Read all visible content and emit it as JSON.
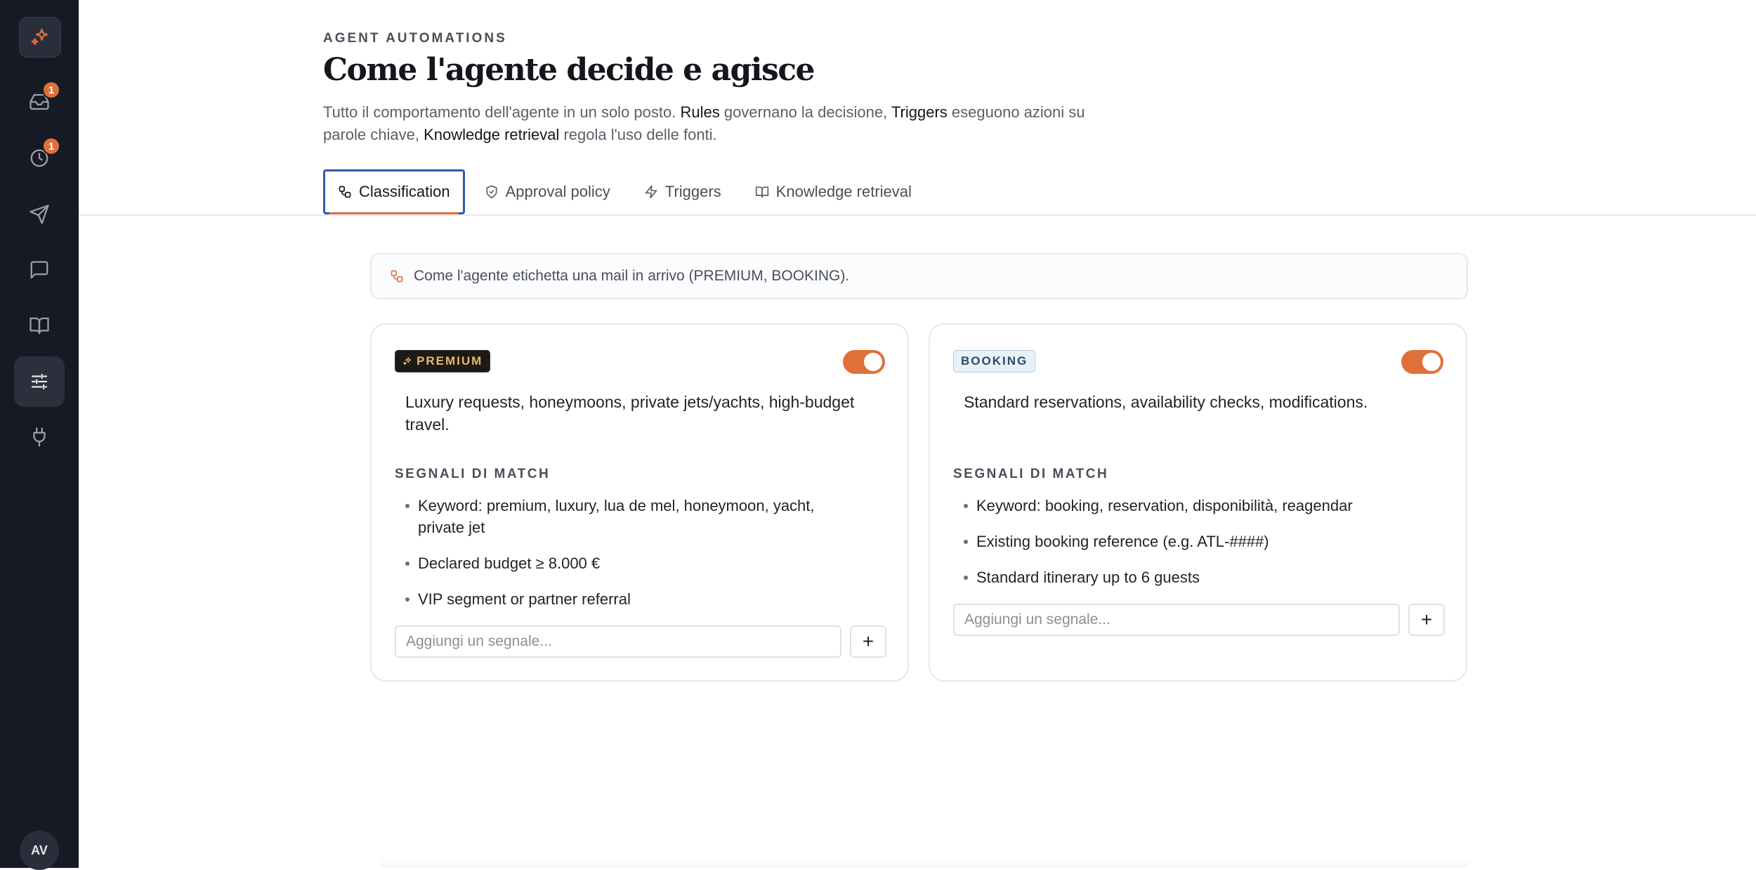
{
  "sidebar": {
    "logo_icon": "sparkle-icon",
    "items": [
      {
        "icon": "inbox-icon",
        "badge": "1"
      },
      {
        "icon": "clock-icon",
        "badge": "1"
      },
      {
        "icon": "send-icon",
        "badge": ""
      },
      {
        "icon": "chat-icon",
        "badge": ""
      },
      {
        "icon": "book-icon",
        "badge": ""
      },
      {
        "icon": "sliders-icon",
        "badge": "",
        "active": true
      },
      {
        "icon": "plug-icon",
        "badge": ""
      }
    ],
    "avatar": "AV"
  },
  "header": {
    "eyebrow": "AGENT AUTOMATIONS",
    "title": "Come l'agente decide e agisce",
    "desc_1": "Tutto il comportamento dell'agente in un solo posto. ",
    "desc_rules": "Rules",
    "desc_2": " governano la decisione, ",
    "desc_triggers": "Triggers",
    "desc_3": " eseguono azioni su parole chiave, ",
    "desc_knowledge": "Knowledge retrieval",
    "desc_4": " regola l'uso delle fonti."
  },
  "tabs": [
    {
      "label": "Classification",
      "icon": "classification-icon",
      "active": true
    },
    {
      "label": "Approval policy",
      "icon": "shield-check-icon"
    },
    {
      "label": "Triggers",
      "icon": "lightning-icon"
    },
    {
      "label": "Knowledge retrieval",
      "icon": "book-open-icon"
    }
  ],
  "info": {
    "text": "Come l'agente etichetta una mail in arrivo (PREMIUM, BOOKING).",
    "icon": "classification-icon"
  },
  "cards": [
    {
      "tag": "PREMIUM",
      "enabled": true,
      "description": "Luxury requests, honeymoons, private jets/yachts, high-budget travel.",
      "signals_label": "SEGNALI DI MATCH",
      "signals": [
        "Keyword: premium, luxury, lua de mel, honeymoon, yacht, private jet",
        "Declared budget ≥ 8.000 €",
        "VIP segment or partner referral"
      ],
      "input_placeholder": "Aggiungi un segnale...",
      "add_label": "+"
    },
    {
      "tag": "BOOKING",
      "enabled": true,
      "description": "Standard reservations, availability checks, modifications.",
      "signals_label": "SEGNALI DI MATCH",
      "signals": [
        "Keyword: booking, reservation, disponibilità, reagendar",
        "Existing booking reference (e.g. ATL-####)",
        "Standard itinerary up to 6 guests"
      ],
      "input_placeholder": "Aggiungi un segnale...",
      "add_label": "+"
    }
  ],
  "colors": {
    "accent": "#e0703a",
    "sidebar_bg": "#161a25",
    "active_tab_border": "#2f5aa8"
  }
}
